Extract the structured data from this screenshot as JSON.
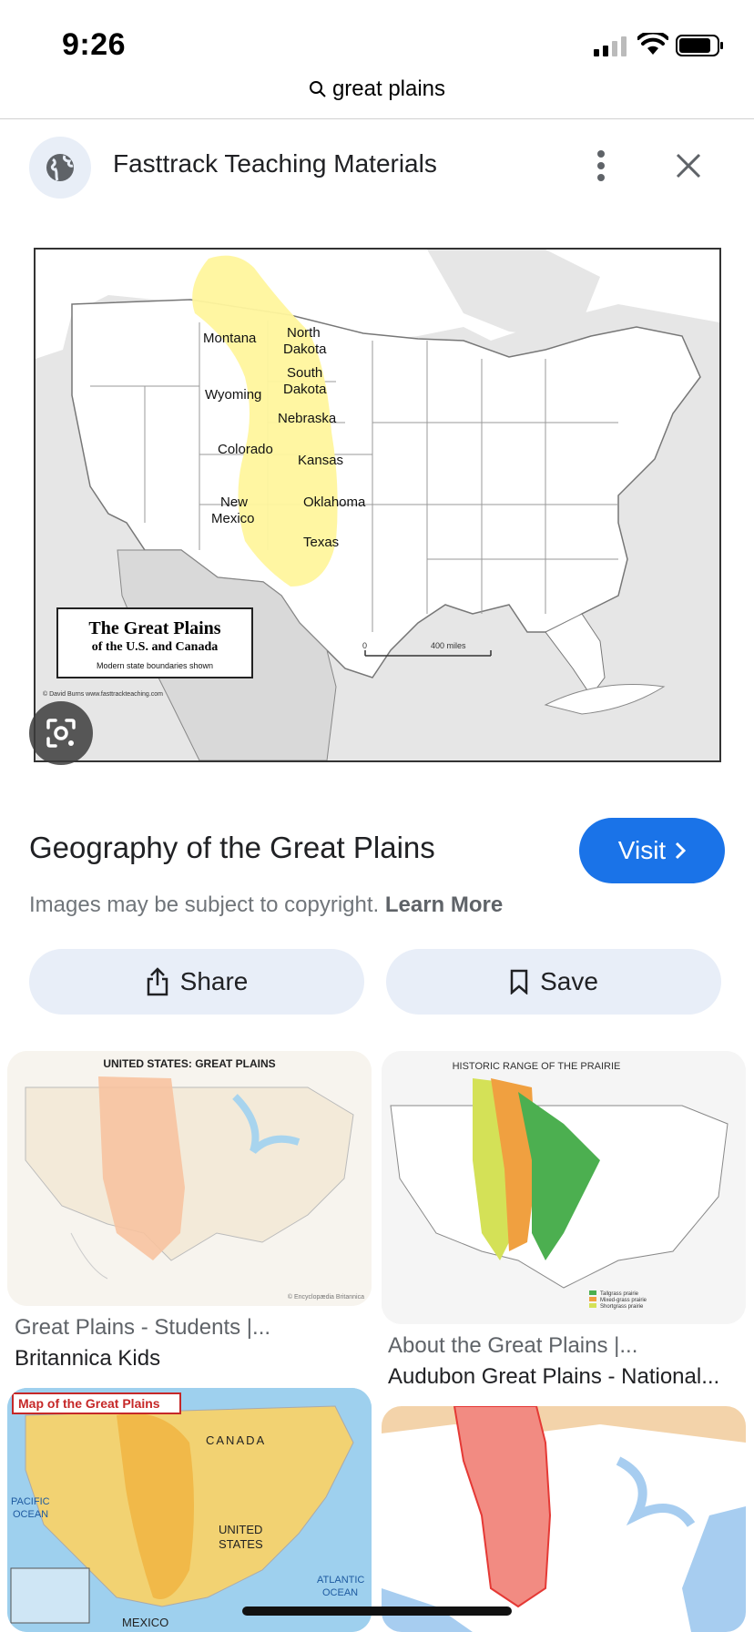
{
  "status_bar": {
    "time": "9:26"
  },
  "url_bar": {
    "query": "great plains"
  },
  "source": {
    "name": "Fasttrack Teaching Materials"
  },
  "main_image": {
    "states": [
      "Montana",
      "North",
      "Dakota",
      "South",
      "Dakota",
      "Wyoming",
      "Nebraska",
      "Colorado",
      "Kansas",
      "New",
      "Mexico",
      "Oklahoma",
      "Texas"
    ],
    "legend_title": "The Great Plains",
    "legend_subtitle": "of the U.S. and Canada",
    "legend_note": "Modern state boundaries shown",
    "credit": "© David Burns   www.fasttrackteaching.com",
    "scale_start": "0",
    "scale_end": "400 miles",
    "highlight_color": "#fff59d"
  },
  "result": {
    "title": "Geography of the Great Plains",
    "visit_label": "Visit",
    "copyright_text": "Images may be subject to copyright.",
    "learn_more": "Learn More"
  },
  "actions": {
    "share": "Share",
    "save": "Save"
  },
  "related": [
    {
      "image_title": "UNITED STATES: GREAT PLAINS",
      "image_credit": "© Encyclopædia Britannica",
      "line1": "Great Plains - Students |...",
      "line2": "Britannica Kids",
      "highlight_color": "#f7c3a0"
    },
    {
      "image_title": "HISTORIC RANGE OF THE PRAIRIE",
      "legend": [
        "Tallgrass prairie",
        "Mixed-grass prairie",
        "Shortgrass prairie"
      ],
      "line1": "About the Great Plains |...",
      "line2": "Audubon Great Plains - National...",
      "colors": [
        "#4caf50",
        "#f0a040",
        "#d4e157"
      ]
    },
    {
      "image_title": "Map of the Great Plains",
      "labels": [
        "CANADA",
        "UNITED",
        "STATES",
        "PACIFIC",
        "OCEAN",
        "ATLANTIC",
        "OCEAN",
        "MEXICO"
      ]
    },
    {
      "highlight_color": "#f28b82"
    }
  ],
  "colors": {
    "accent": "#1a73e8",
    "button_bg": "#e8eef8"
  }
}
